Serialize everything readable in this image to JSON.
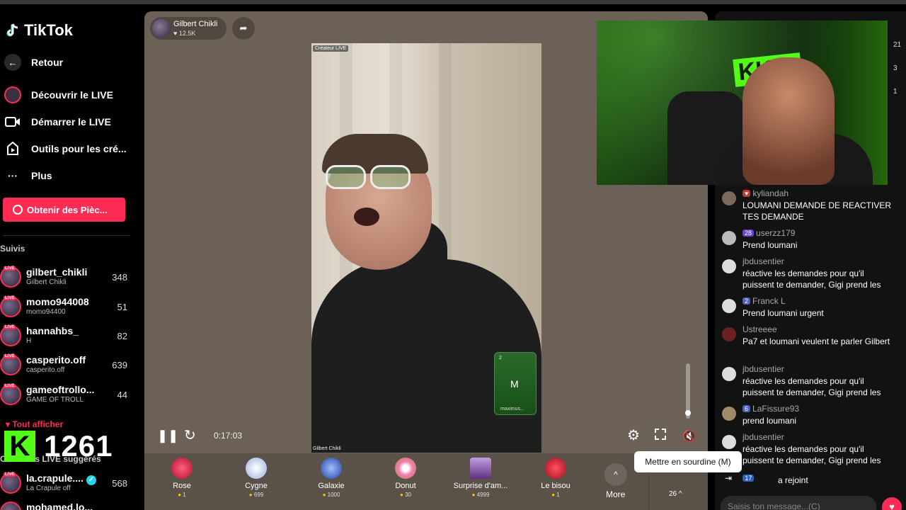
{
  "app": {
    "name": "TikTok"
  },
  "sidebar": {
    "back": "Retour",
    "nav": [
      {
        "label": "Découvrir le LIVE"
      },
      {
        "label": "Démarrer le LIVE"
      },
      {
        "label": "Outils pour les cré..."
      },
      {
        "label": "Plus"
      }
    ],
    "coins_button": "Obtenir des Pièc...",
    "following_title": "Suivis",
    "live_tag": "LIVE",
    "following": [
      {
        "name": "gilbert_chikli",
        "sub": "Gilbert Chikli",
        "count": "348"
      },
      {
        "name": "momo944008",
        "sub": "momo94400",
        "count": "51"
      },
      {
        "name": "hannahbs_",
        "sub": "H",
        "count": "82"
      },
      {
        "name": "casperito.off",
        "sub": "casperito.off",
        "count": "639"
      },
      {
        "name": "gameoftrollo...",
        "sub": "GAME OF TROLL",
        "count": "44"
      }
    ],
    "see_all": "Tout afficher",
    "kick_letter": "K",
    "kick_viewers": "1261",
    "suggested_title": "Créateurs LIVE suggérés",
    "suggested": [
      {
        "name": "la.crapule....",
        "sub": "La Crapule off",
        "count": "568",
        "verified_icon": "✓"
      },
      {
        "name": "mohamed.lo...",
        "sub": "",
        "count": ""
      }
    ]
  },
  "stream": {
    "host_name": "Gilbert Chikli",
    "host_likes": "12.5K",
    "creator_tag": "Créateur LIVE",
    "watermark": "Gilbert Chikli",
    "guest_letter": "M",
    "guest_name": "maximus...",
    "guest_top": "2",
    "time": "0:17:03",
    "volume_level": 0.1,
    "tooltip": "Mettre en sourdine (M)"
  },
  "gifts": [
    {
      "name": "Rose",
      "price": "1",
      "color": "#e0305a"
    },
    {
      "name": "Cygne",
      "price": "699",
      "color": "#e8f0ff"
    },
    {
      "name": "Galaxie",
      "price": "1000",
      "color": "#6080e0"
    },
    {
      "name": "Donut",
      "price": "30",
      "color": "#f0a0c0"
    },
    {
      "name": "Surprise d'am...",
      "price": "4999",
      "color": "#a080c0"
    },
    {
      "name": "Le bisou",
      "price": "1",
      "color": "#e03040"
    }
  ],
  "gift_bar": {
    "more_label": "More",
    "more_icon": "^",
    "side_count": "26 ^"
  },
  "right": {
    "viewer_nums": [
      "21",
      "3",
      "1"
    ],
    "cam_logo": "KICK",
    "chat": [
      {
        "user": "kyliandah",
        "badge": "",
        "text": "LOUMANI DEMANDE DE REACTIVER TES DEMANDE",
        "avatar": "#7a6a5a"
      },
      {
        "user": "userzz179",
        "badge": "28",
        "text": "Prend loumani",
        "avatar": "#bbbbbb"
      },
      {
        "user": "jbdusentier",
        "badge": "",
        "text": "réactive les demandes pour qu'il puissent te demander, Gigi prend les",
        "avatar": "#dddddd"
      },
      {
        "user": "Franck L",
        "badge": "2",
        "text": "Prend loumani urgent",
        "avatar": "#dddddd"
      },
      {
        "user": "Ustreeee",
        "badge": "",
        "text": "Pa7 et loumani veulent te parler Gilbert",
        "avatar": "#6a2020"
      },
      {
        "user": "jbdusentier",
        "badge": "",
        "text": "réactive les demandes pour qu'il puissent te demander, Gigi prend les",
        "avatar": "#dddddd"
      },
      {
        "user": "LaFissure93",
        "badge": "6",
        "text": "prend loumani",
        "avatar": "#a08a6a"
      },
      {
        "user": "jbdusentier",
        "badge": "",
        "text": "réactive les demandes pour qu'il puissent te demander, Gigi prend les",
        "avatar": "#dddddd"
      }
    ],
    "joined_badge": "17",
    "joined_text": "a rejoint",
    "input_placeholder": "Saisis ton message...(C)"
  },
  "colors": {
    "accent": "#fe2c55",
    "kick": "#53fc18",
    "stage": "#6b6156"
  }
}
